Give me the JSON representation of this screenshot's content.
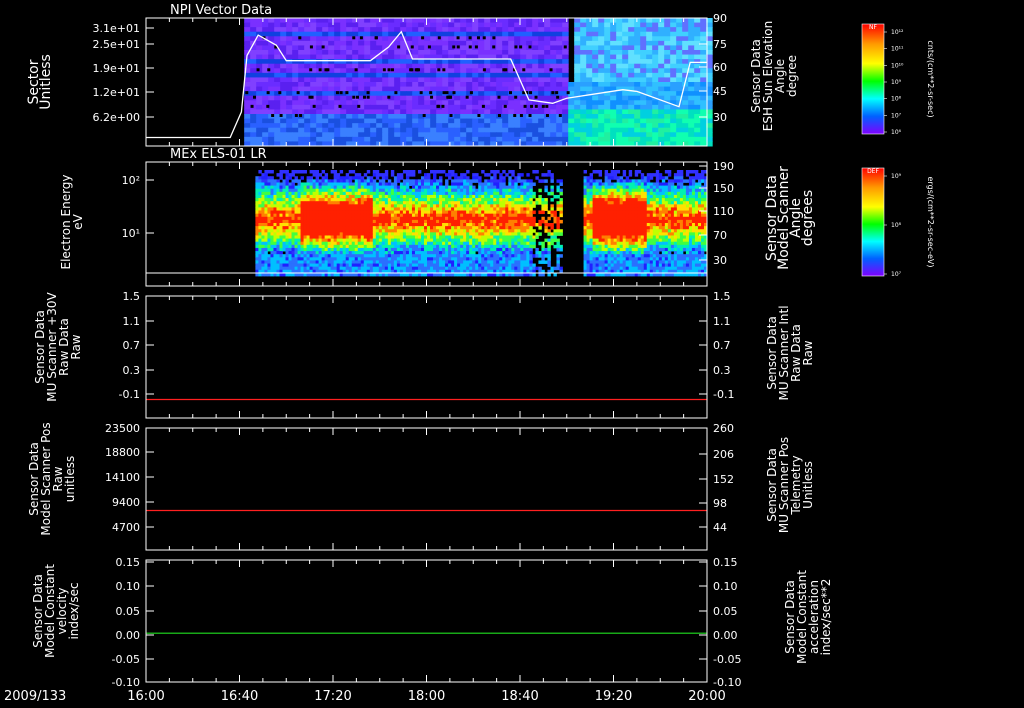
{
  "date_label": "2009/133",
  "x_ticks": [
    "16:00",
    "16:40",
    "17:20",
    "18:00",
    "18:40",
    "19:20",
    "20:00"
  ],
  "colors": {
    "background": "#000000",
    "axis": "#ffffff",
    "red_trace": "#ff2020",
    "green_trace": "#20e020"
  },
  "chart_data": [
    {
      "type": "heatmap",
      "title": "NPI Vector Data",
      "ylabel_lines": [
        "Sector",
        "Unitless"
      ],
      "y_ticks": [
        "3.1e+01",
        "2.5e+01",
        "1.9e+01",
        "1.2e+01",
        "6.2e+00"
      ],
      "right_label_lines": [
        "Sensor Data",
        "ESH Sun Elevation",
        "Angle",
        "degree"
      ],
      "right_ticks": [
        "90",
        "75",
        "60",
        "45",
        "30"
      ],
      "colorbar_title": "NF",
      "colorbar_ticks": [
        "10¹²",
        "10¹¹",
        "10¹⁰",
        "10⁹",
        "10⁸",
        "10⁷",
        "10⁶"
      ],
      "colorbar_units": "cnts/(cm**2-sr-sec)",
      "overlay_line": {
        "name": "ESH Sun Elevation",
        "times_hr": [
          16.0,
          16.6,
          16.68,
          16.72,
          16.8,
          16.93,
          17.0,
          17.6,
          17.73,
          17.82,
          17.9,
          18.6,
          18.73,
          18.9,
          19.0,
          19.4,
          19.5,
          19.8,
          19.88,
          20.0
        ],
        "values": [
          20,
          20,
          35,
          68,
          80,
          74,
          65,
          65,
          73,
          82,
          66,
          66,
          42,
          40,
          43,
          48,
          47,
          38,
          64,
          64
        ]
      }
    },
    {
      "type": "heatmap",
      "title": "MEx ELS-01 LR",
      "ylabel_lines": [
        "Electron Energy",
        "eV"
      ],
      "y_ticks": [
        "10²",
        "10¹"
      ],
      "right_label_lines": [
        "Sensor Data",
        "Model Scanner",
        "Angle",
        "degrees"
      ],
      "right_ticks": [
        "190",
        "150",
        "110",
        "70",
        "30"
      ],
      "colorbar_title": "DEF",
      "colorbar_ticks": [
        "10⁹",
        "10⁸",
        "10⁷"
      ],
      "colorbar_units": "ergs/(cm**2-sr-sec-eV)"
    },
    {
      "type": "line",
      "ylabel_lines": [
        "Sensor Data",
        "MU Scanner +30V",
        "Raw Data",
        "Raw"
      ],
      "y_ticks": [
        "1.5",
        "1.1",
        "0.7",
        "0.3",
        "-0.1"
      ],
      "ylim": [
        -0.35,
        1.5
      ],
      "right_label_lines": [
        "Sensor Data",
        "MU Scanner Intl",
        "Raw Data",
        "Raw"
      ],
      "right_ticks": [
        "1.5",
        "1.1",
        "0.7",
        "0.3",
        "-0.1"
      ],
      "series": [
        {
          "color": "#ff2020",
          "x": [
            "16:00",
            "20:00"
          ],
          "values": [
            -0.07,
            -0.07
          ]
        }
      ]
    },
    {
      "type": "line",
      "ylabel_lines": [
        "Sensor Data",
        "Model Scanner Pos",
        "Raw",
        "unitless"
      ],
      "y_ticks": [
        "23500",
        "18800",
        "14100",
        "9400",
        "4700"
      ],
      "ylim": [
        0,
        23500
      ],
      "right_label_lines": [
        "Sensor Data",
        "MU Scanner Pos",
        "Telemetry",
        "Unitless"
      ],
      "right_ticks": [
        "260",
        "206",
        "152",
        "98",
        "44"
      ],
      "series": [
        {
          "color": "#ff2020",
          "x": [
            "16:00",
            "20:00"
          ],
          "values": [
            7600,
            7600
          ]
        }
      ]
    },
    {
      "type": "line",
      "ylabel_lines": [
        "Sensor Data",
        "Model Constant",
        "velocity",
        "index/sec"
      ],
      "y_ticks": [
        "0.15",
        "0.10",
        "0.05",
        "0.00",
        "-0.05",
        "-0.10"
      ],
      "ylim": [
        -0.1,
        0.15
      ],
      "right_label_lines": [
        "Sensor Data",
        "Model Constant",
        "acceleration",
        "index/sec**2"
      ],
      "right_ticks": [
        "0.15",
        "0.10",
        "0.05",
        "0.00",
        "-0.05",
        "-0.10"
      ],
      "series": [
        {
          "color": "#20e020",
          "x": [
            "16:00",
            "20:00"
          ],
          "values": [
            0.0,
            0.0
          ]
        }
      ]
    }
  ]
}
